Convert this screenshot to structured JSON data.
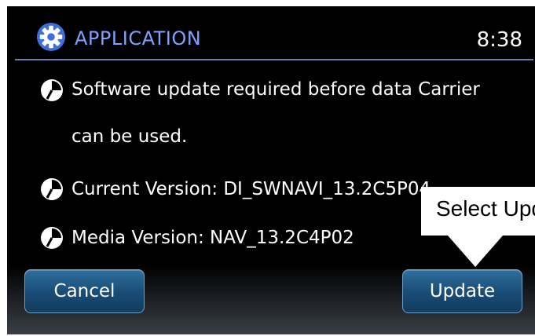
{
  "header": {
    "title": "APPLICATION",
    "time": "8:38",
    "icon": "gear-icon",
    "accent_color": "#7ea2ff"
  },
  "messages": [
    {
      "icon": "clock-icon",
      "text": "Software update required before data Carrier"
    },
    {
      "icon": "",
      "text": "can be used."
    },
    {
      "icon": "clock-icon",
      "text": "Current Version: DI_SWNAVI_13.2C5P04"
    },
    {
      "icon": "clock-icon",
      "text": "Media Version: NAV_13.2C4P02"
    }
  ],
  "buttons": {
    "cancel_label": "Cancel",
    "update_label": "Update"
  },
  "callout": {
    "text": "Select Update"
  }
}
